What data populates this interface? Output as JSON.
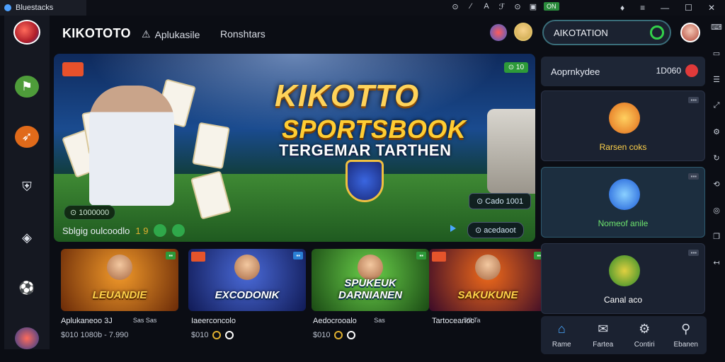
{
  "window": {
    "title": "Bluestacks",
    "tray": {
      "badge": "ON"
    },
    "controls": {
      "minimize": "—",
      "maximize": "☐",
      "close": "✕"
    }
  },
  "header": {
    "brand": "KIKOTOTO",
    "nav_1": "Aplukasile",
    "nav_2": "Ronshtars",
    "search_value": "AIKOTATION"
  },
  "hero": {
    "title_1": "KIKOTTO",
    "title_2": "SPORTSBOOK",
    "title_3": "TERGEMAR TARTHEN",
    "badge_top_right": "⊙ 10",
    "pill_left": "⊙ 1000000",
    "pill_right_top": "⊙ Cado 1001",
    "pill_right_bottom": "⊙ acedaoot",
    "caption": "Sblgig oulcoodlo",
    "caption_num": "1 9"
  },
  "tiles": [
    {
      "name": "LEUANDIE",
      "title": "Aplukaneoo 3J",
      "sub": "$010 1080b - 7.990",
      "side": "Sas Sas"
    },
    {
      "name": "EXCODONIK",
      "title": "Iaeerconcolo",
      "sub": "$010",
      "side": ""
    },
    {
      "name": "SPUKEUK DARNIANEN",
      "title": "Aedocrooalo",
      "sub": "$010",
      "side": "Sas"
    },
    {
      "name": "SAKUKUNE",
      "title": "Tartoceanoo",
      "sub": "",
      "side": "7/3 Ta"
    }
  ],
  "right_panel": {
    "head_label": "Aoprnkydee",
    "head_value": "1D060",
    "cards": [
      {
        "label": "Rarsen coks",
        "dots": "▪▪▪"
      },
      {
        "label": "Nomeof anile",
        "dots": "▪▪▪"
      },
      {
        "label": "Canal aco",
        "dots": "▪▪▪"
      }
    ]
  },
  "bottom_nav": [
    {
      "label": "Rame",
      "icon": "home-icon"
    },
    {
      "label": "Fartea",
      "icon": "mail-icon"
    },
    {
      "label": "Contiri",
      "icon": "gear-icon"
    },
    {
      "label": "Ebanen",
      "icon": "search-icon"
    }
  ]
}
